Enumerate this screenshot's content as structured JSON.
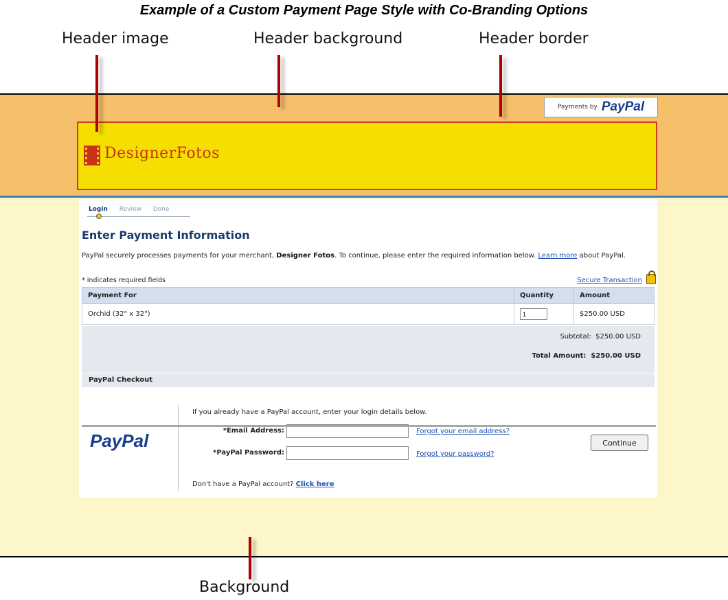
{
  "caption": {
    "title": "Example of a Custom Payment Page Style with Co-Branding Options",
    "header_image": "Header image",
    "header_background": "Header background",
    "header_border": "Header border",
    "background": "Background"
  },
  "header": {
    "payments_by": "Payments by",
    "paypal": "PayPal",
    "logo_text": "DesignerFotos"
  },
  "steps": [
    "Login",
    "Review",
    "Done"
  ],
  "main": {
    "title": "Enter Payment Information",
    "intro_pre": "PayPal securely processes payments for your merchant, ",
    "merchant": "Designer Fotos",
    "intro_mid": ". To continue, please enter the required information below. ",
    "learn_more": "Learn more",
    "intro_post": " about PayPal.",
    "required_note": "* indicates required fields",
    "secure": "Secure Transaction"
  },
  "table": {
    "headers": [
      "Payment For",
      "Quantity",
      "Amount"
    ],
    "rows": [
      {
        "item": "Orchid (32\" x 32\")",
        "quantity": "1",
        "amount": "$250.00 USD"
      }
    ],
    "subtotal_label": "Subtotal:",
    "subtotal": "$250.00 USD",
    "total_label": "Total Amount:",
    "total": "$250.00 USD"
  },
  "checkout": {
    "heading": "PayPal Checkout",
    "logo": "PayPal",
    "intro": "If you already have a PayPal account, enter your login details below.",
    "email_label": "*Email Address:",
    "password_label": "*PayPal Password:",
    "forgot_email": "Forgot your email address?",
    "forgot_password": "Forgot your password?",
    "no_account": "Don't have a PayPal account? ",
    "click_here": "Click here"
  },
  "continue": "Continue",
  "colors": {
    "header_bg": "#f6bf6a",
    "header_image_bg": "#f5df00",
    "header_border": "#d13a1a",
    "page_bg": "#fdf6c8",
    "pointer": "#b00000"
  }
}
